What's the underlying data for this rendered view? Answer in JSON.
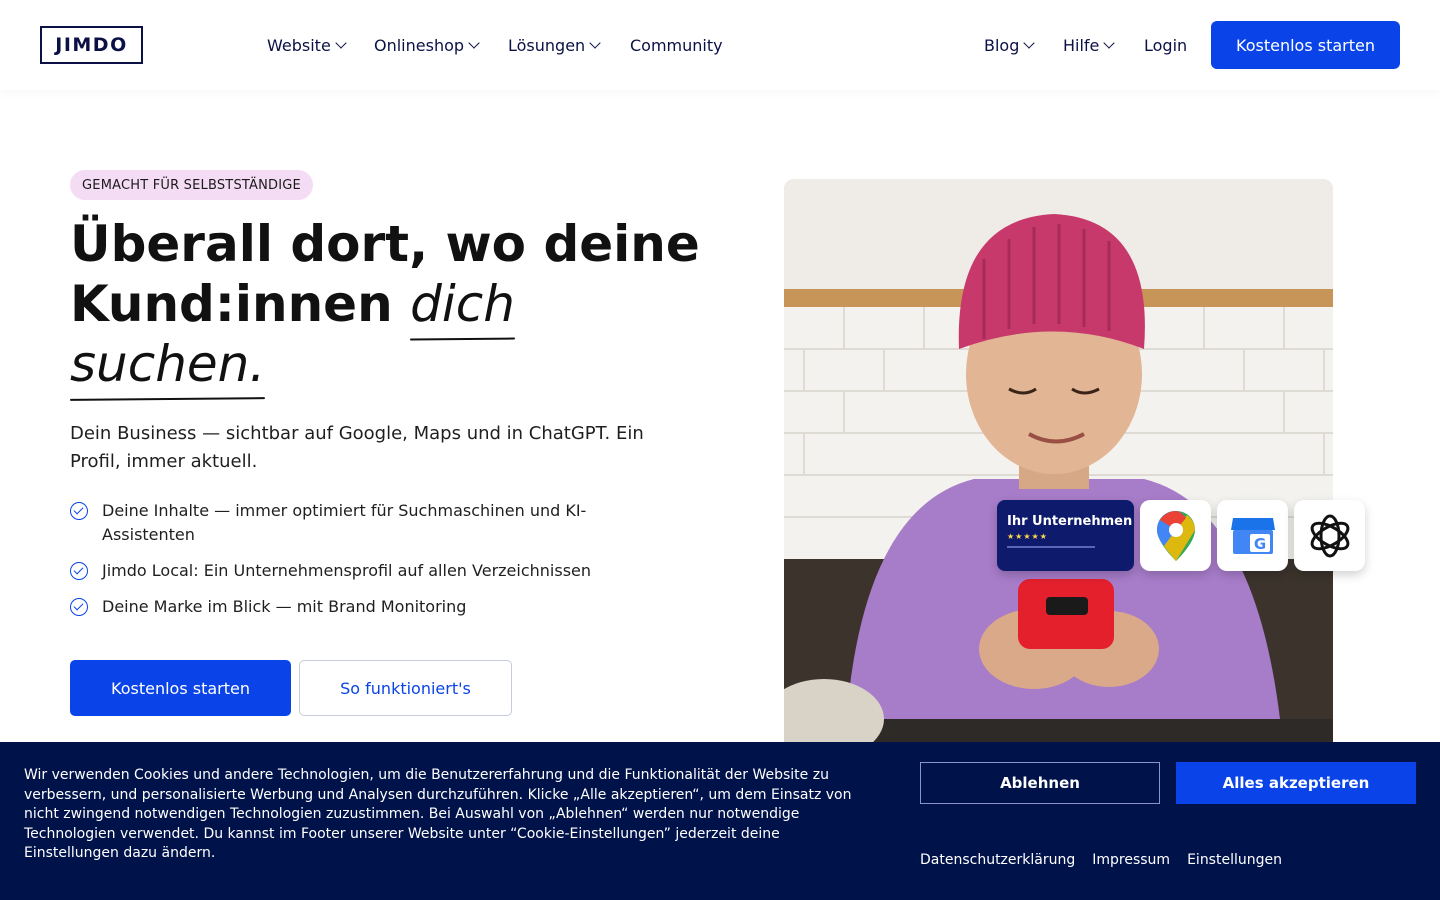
{
  "header": {
    "logo": "JIMDO",
    "nav": [
      {
        "label": "Website",
        "has_dropdown": true
      },
      {
        "label": "Onlineshop",
        "has_dropdown": true
      },
      {
        "label": "Lösungen",
        "has_dropdown": true
      },
      {
        "label": "Community",
        "has_dropdown": false
      }
    ],
    "right_nav": [
      {
        "label": "Blog",
        "has_dropdown": true
      },
      {
        "label": "Hilfe",
        "has_dropdown": true
      },
      {
        "label": "Login",
        "has_dropdown": false
      }
    ],
    "cta": "Kostenlos starten"
  },
  "hero": {
    "badge": "GEMACHT FÜR SELBSTSTÄNDIGE",
    "headline": {
      "part1": "Überall dort, wo deine Kund:innen ",
      "italic1": "dich",
      "italic2": "suchen."
    },
    "subline": "Dein Business — sichtbar auf Google, Maps und in ChatGPT. Ein Profil, immer aktuell.",
    "bullets": [
      "Deine Inhalte — immer optimiert für Suchmaschinen und KI-Assistenten",
      "Jimdo Local: Ein Unternehmensprofil auf allen Verzeichnissen",
      "Deine Marke im Blick — mit Brand Monitoring"
    ],
    "primary_button": "Kostenlos starten",
    "secondary_button": "So funktioniert's",
    "business_card": {
      "title": "Ihr Unternehmen",
      "stars": "★★★★★"
    },
    "app_icons": [
      "google-maps-icon",
      "google-business-icon",
      "chatgpt-icon"
    ]
  },
  "cookie_banner": {
    "text": "Wir verwenden Cookies und andere Technologien, um die Benutzererfahrung und die Funktionalität der Website zu verbessern, und personalisierte Werbung und Analysen durchzuführen. Klicke „Alle akzeptieren“, um dem Einsatz von nicht zwingend notwendigen Technologien zuzustimmen. Bei Auswahl von „Ablehnen“ werden nur notwendige Technologien verwendet. Du kannst im Footer unserer Website unter “Cookie-Einstellungen” jederzeit deine Einstellungen dazu ändern.",
    "reject": "Ablehnen",
    "accept": "Alles akzeptieren",
    "links": [
      "Datenschutzerklärung",
      "Impressum",
      "Einstellungen"
    ]
  },
  "colors": {
    "accent": "#0a44e8",
    "navy": "#00124a",
    "badge_bg": "#f4dcf4"
  }
}
